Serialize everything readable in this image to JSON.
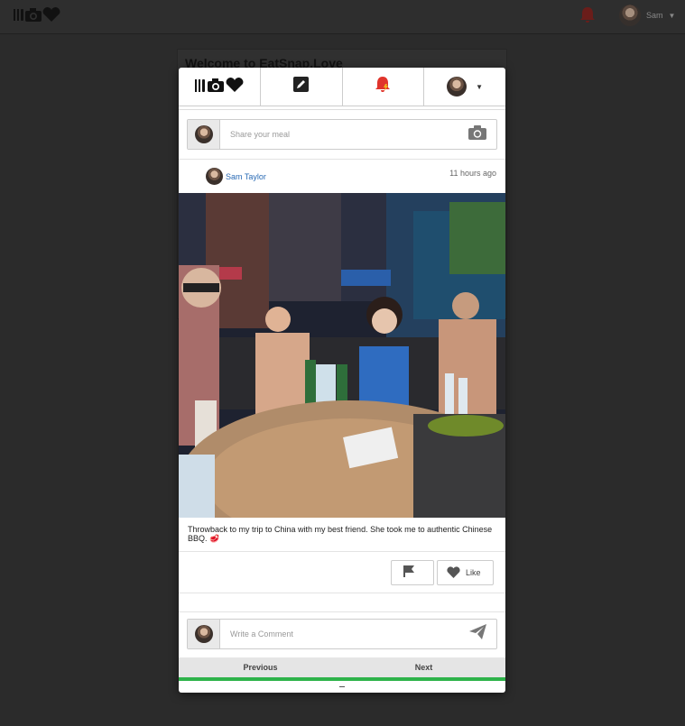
{
  "background": {
    "title": "Welcome to EatSnap.Love",
    "user_name": "Sam"
  },
  "modal": {
    "share_placeholder": "Share your meal",
    "post": {
      "author": "Sam Taylor",
      "time": "11 hours ago",
      "caption": "Throwback to my trip to China with my best friend. She took me to authentic Chinese BBQ. 🥩",
      "like_label": "Like"
    },
    "comment_placeholder": "Write a Comment",
    "pager": {
      "previous": "Previous",
      "next": "Next",
      "progress": 1.0
    }
  },
  "colors": {
    "link": "#2a6bb5",
    "bell": "#e0342c",
    "progress": "#2eb34a"
  },
  "icons": [
    "logo-icon",
    "edit-icon",
    "bell-icon",
    "camera-icon",
    "flag-icon",
    "heart-icon",
    "send-icon"
  ]
}
